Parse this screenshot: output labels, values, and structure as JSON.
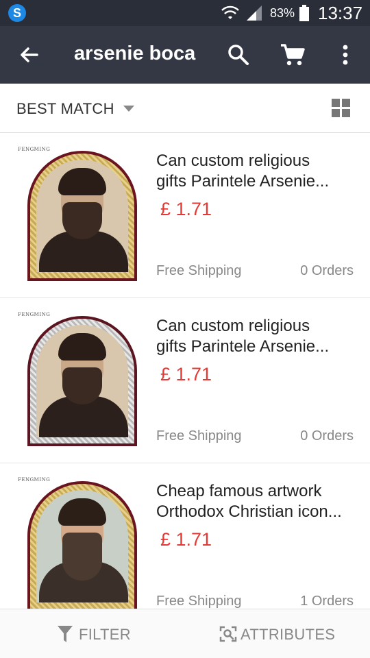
{
  "status_bar": {
    "app_icon_letter": "S",
    "battery_percent": "83%",
    "time": "13:37"
  },
  "toolbar": {
    "search_query": "arsenie boca",
    "icons": [
      "back-arrow-icon",
      "search-icon",
      "cart-icon",
      "more-vert-icon"
    ]
  },
  "sort": {
    "label": "BEST MATCH",
    "icon": "grid-view-icon"
  },
  "products": [
    {
      "title_line1": "Can custom religious",
      "title_line2": "gifts Parintele Arsenie...",
      "price": "£ 1.71",
      "shipping": "Free Shipping",
      "orders": "0 Orders",
      "thumb_brand": "FENGMING",
      "frame": "gold",
      "portrait": "sepia"
    },
    {
      "title_line1": "Can custom religious",
      "title_line2": "gifts Parintele Arsenie...",
      "price": "£ 1.71",
      "shipping": "Free Shipping",
      "orders": "0 Orders",
      "thumb_brand": "FENGMING",
      "frame": "silver",
      "portrait": "sepia"
    },
    {
      "title_line1": "Cheap famous artwork",
      "title_line2": "Orthodox Christian icon...",
      "price": "£ 1.71",
      "shipping": "Free Shipping",
      "orders": "1 Orders",
      "thumb_brand": "FENGMING",
      "frame": "gold",
      "portrait": "color"
    }
  ],
  "bottom_bar": {
    "filter_label": "FILTER",
    "attributes_label": "ATTRIBUTES"
  },
  "colors": {
    "status_bar_bg": "#2a2e39",
    "toolbar_bg": "#343845",
    "price_red": "#e53935",
    "muted_text": "#888888"
  }
}
